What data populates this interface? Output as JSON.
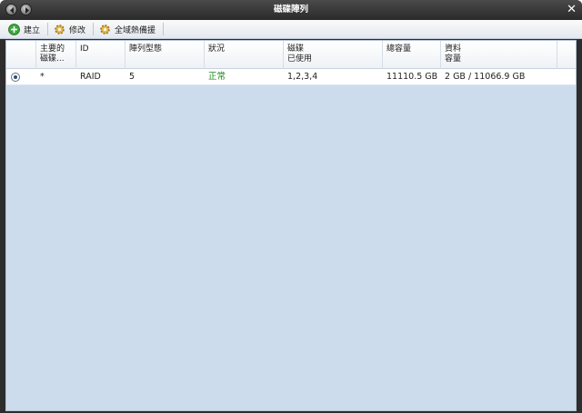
{
  "window": {
    "title": "磁碟陣列"
  },
  "toolbar": {
    "create_label": "建立",
    "modify_label": "修改",
    "global_spare_label": "全域熱備援"
  },
  "table": {
    "headers": {
      "primary_line1": "主要的",
      "primary_line2": "磁碟...",
      "id": "ID",
      "raid_type": "陣列型態",
      "status": "狀況",
      "disks_line1": "磁碟",
      "disks_line2": "已使用",
      "total_capacity": "總容量",
      "data_line1": "資料",
      "data_line2": "容量"
    },
    "rows": [
      {
        "primary": "*",
        "id": "RAID",
        "raid_type": "5",
        "status": "正常",
        "disks_used": "1,2,3,4",
        "total_capacity": "11110.5 GB",
        "data_capacity": "2 GB / 11066.9 GB"
      }
    ]
  },
  "colors": {
    "status_ok": "#1a8a1a",
    "grid_background": "#cddcec"
  }
}
